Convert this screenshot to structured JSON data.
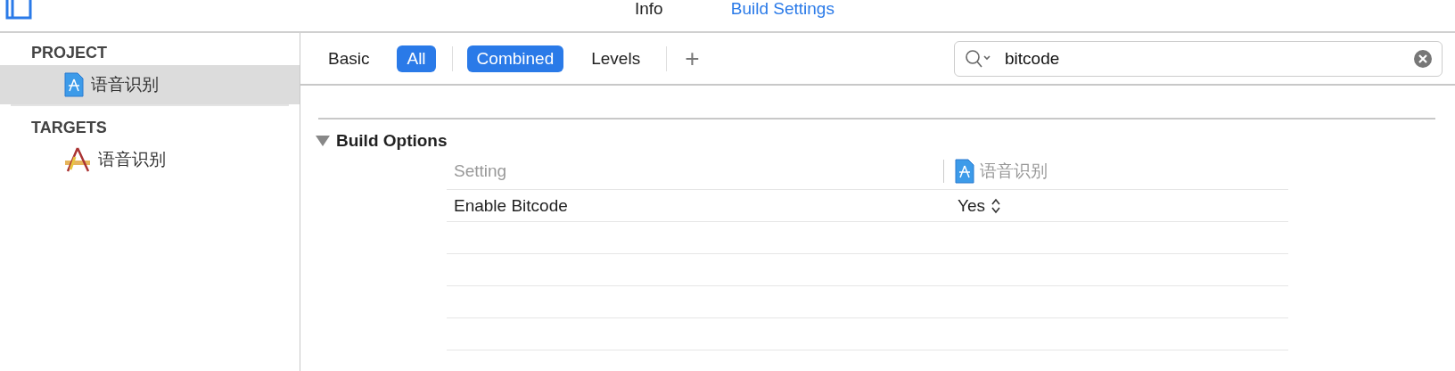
{
  "editor_tabs": [
    {
      "label": "Info",
      "selected": false
    },
    {
      "label": "Build Settings",
      "selected": true
    }
  ],
  "sidebar": {
    "sections": [
      {
        "title": "PROJECT",
        "items": [
          {
            "label": "语音识别",
            "kind": "project",
            "selected": true
          }
        ]
      },
      {
        "title": "TARGETS",
        "items": [
          {
            "label": "语音识别",
            "kind": "target",
            "selected": false
          }
        ]
      }
    ]
  },
  "filter_bar": {
    "groups": [
      [
        {
          "label": "Basic",
          "selected": false
        },
        {
          "label": "All",
          "selected": true
        }
      ],
      [
        {
          "label": "Combined",
          "selected": true
        },
        {
          "label": "Levels",
          "selected": false
        }
      ]
    ],
    "add": "+",
    "search": {
      "value": "bitcode"
    }
  },
  "section": {
    "title": "Build Options",
    "expanded": true,
    "columns": [
      {
        "label": "Setting"
      },
      {
        "label": "语音识别"
      }
    ],
    "rows": [
      {
        "setting": "Enable Bitcode",
        "value": "Yes"
      }
    ]
  }
}
